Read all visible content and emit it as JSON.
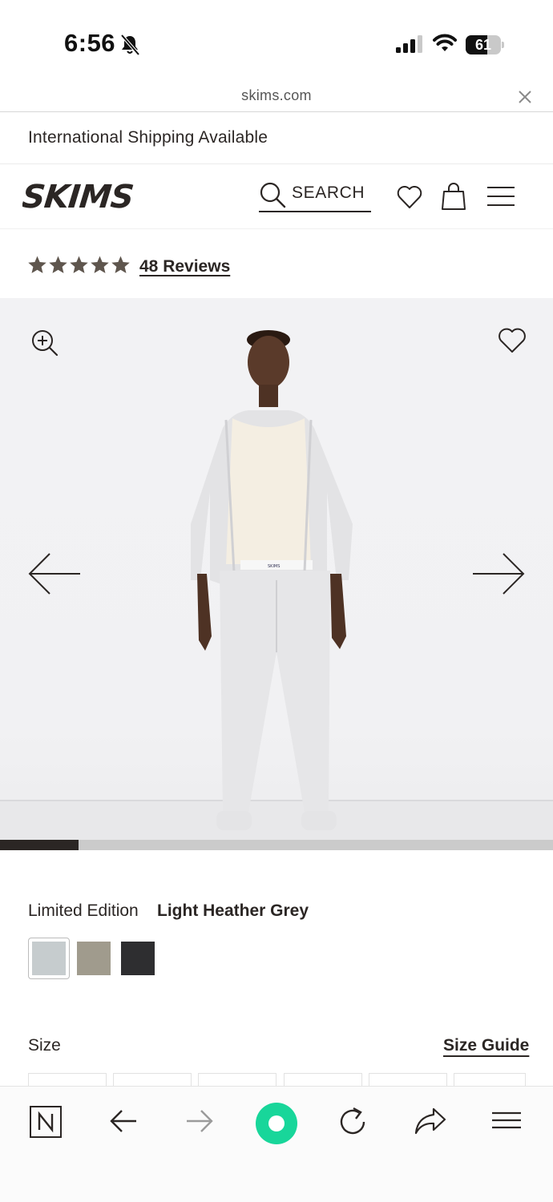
{
  "status_bar": {
    "time": "6:56",
    "battery_level": "61",
    "battery_fraction": 0.61
  },
  "browser": {
    "url": "skims.com"
  },
  "promo": {
    "text": "International Shipping Available"
  },
  "header": {
    "logo_text": "SKIMS",
    "search_label": "SEARCH"
  },
  "reviews": {
    "rating": 5,
    "rating_max": 5,
    "link_text": "48 Reviews"
  },
  "gallery": {
    "progress_fraction": 0.142,
    "image_subject": "model wearing light heather grey zip hoodie, cream tank and jogger pants"
  },
  "color": {
    "label": "Limited Edition",
    "selected_name": "Light Heather Grey",
    "swatches": [
      {
        "name": "Light Heather Grey",
        "hex": "#c6ccce",
        "selected": true
      },
      {
        "name": "Taupe",
        "hex": "#a09b8d",
        "selected": false
      },
      {
        "name": "Black",
        "hex": "#2e2e30",
        "selected": false
      }
    ]
  },
  "size": {
    "label": "Size",
    "guide_link": "Size Guide"
  },
  "colors": {
    "text": "#2b2624",
    "star": "#5f564e",
    "dot_accent": "#18d69a",
    "progress_track": "#cbcbcb"
  },
  "toolbar_icons": [
    "notion-icon",
    "back-arrow-icon",
    "forward-arrow-icon",
    "record-dot-icon",
    "reload-icon",
    "share-icon",
    "menu-icon"
  ]
}
